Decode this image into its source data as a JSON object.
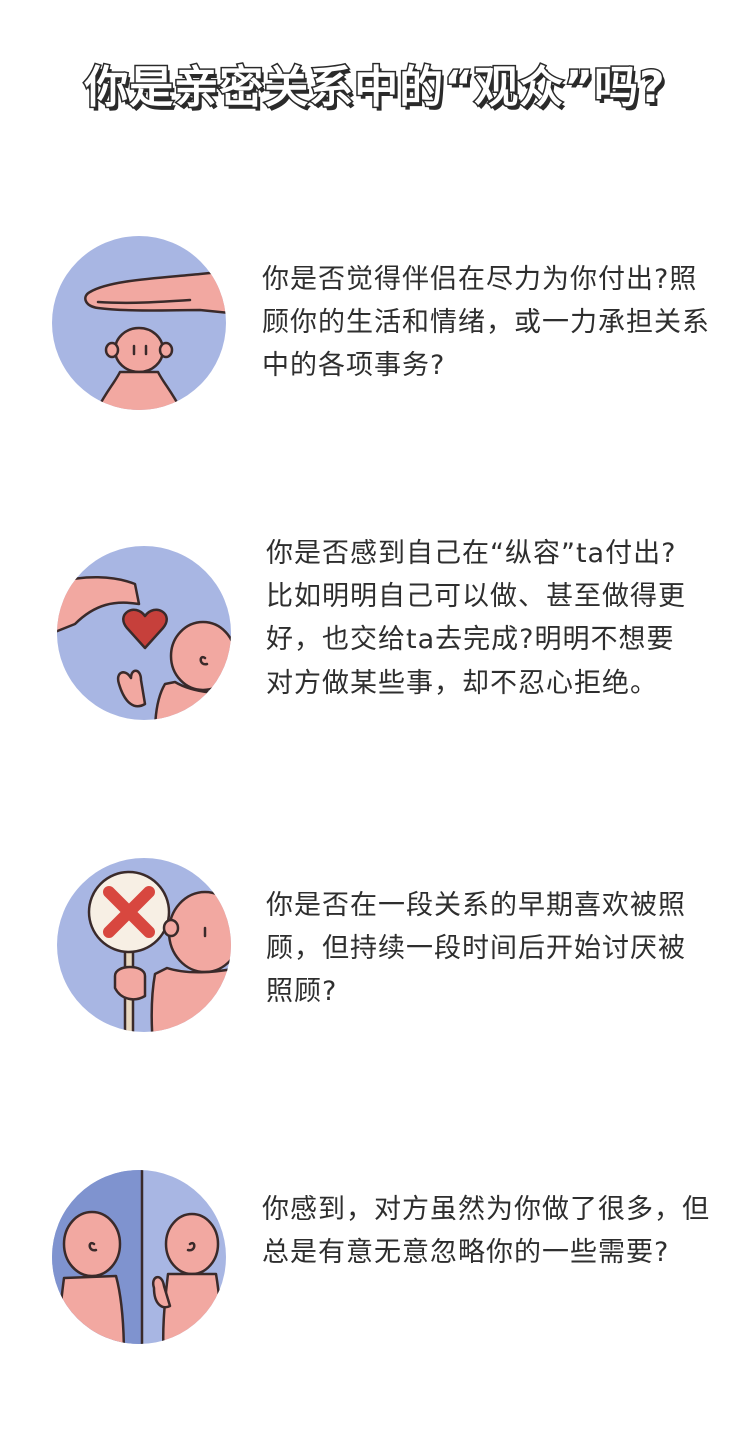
{
  "title": "你是亲密关系中的“观众”吗?",
  "colors": {
    "circle_bg": "#a8b6e3",
    "circle_bg_dark": "#7f93cf",
    "skin": "#f2a8a1",
    "skin_shadow": "#e07b73",
    "outline": "#3a2a2a",
    "heart": "#c6403b",
    "cross": "#d8473f"
  },
  "items": [
    {
      "illustration": "hand-over-head-icon",
      "text": "你是否觉得伴侣在尽力为你付出?照顾你的生活和情绪，或一力承担关系中的各项事务?"
    },
    {
      "illustration": "heart-giving-icon",
      "text": "你是否感到自己在“纵容”ta付出?比如明明自己可以做、甚至做得更好，也交给ta去完成?明明不想要对方做某些事，却不忍心拒绝。"
    },
    {
      "illustration": "cross-sign-icon",
      "text": "你是否在一段关系的早期喜欢被照顾，但持续一段时间后开始讨厌被照顾?"
    },
    {
      "illustration": "two-people-apart-icon",
      "text": "你感到，对方虽然为你做了很多，但总是有意无意忽略你的一些需要?"
    }
  ]
}
